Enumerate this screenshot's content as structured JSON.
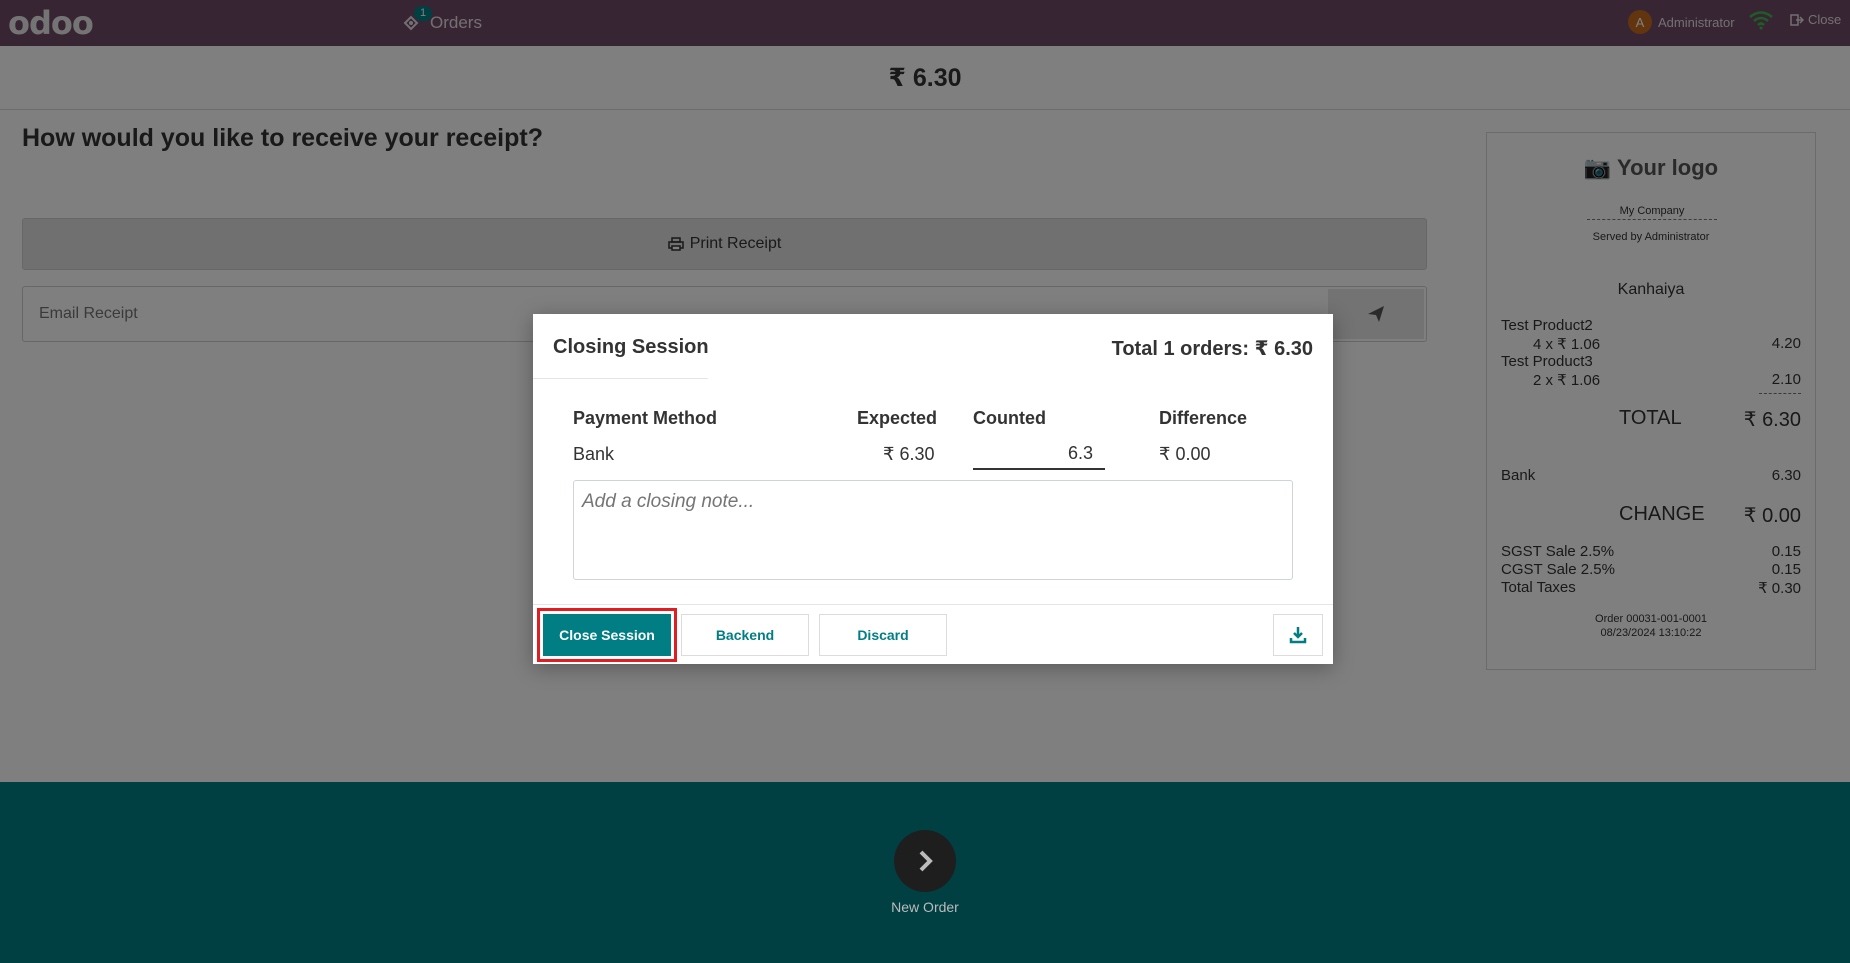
{
  "navbar": {
    "logo": "odoo",
    "orders_label": "Orders",
    "orders_count": "1",
    "user_initial": "A",
    "user_name": "Administrator",
    "close_label": "Close"
  },
  "main": {
    "total": "₹ 6.30",
    "question": "How would you like to receive your receipt?",
    "print_label": "Print Receipt",
    "email_placeholder": "Email Receipt",
    "new_order_label": "New Order"
  },
  "receipt": {
    "logo": "Your logo",
    "company": "My Company",
    "served_by": "Served by Administrator",
    "customer": "Kanhaiya",
    "lines": [
      {
        "product": "Test Product2",
        "qty": "4 x ₹ 1.06",
        "amount": "4.20"
      },
      {
        "product": "Test Product3",
        "qty": "2 x ₹ 1.06",
        "amount": "2.10"
      }
    ],
    "total_label": "TOTAL",
    "total_value": "₹ 6.30",
    "payment_method": "Bank",
    "payment_amount": "6.30",
    "change_label": "CHANGE",
    "change_value": "₹ 0.00",
    "taxes": [
      {
        "label": "SGST Sale 2.5%",
        "value": "0.15"
      },
      {
        "label": "CGST Sale 2.5%",
        "value": "0.15"
      },
      {
        "label": "Total Taxes",
        "value": "₹ 0.30"
      }
    ],
    "order_ref": "Order 00031-001-0001",
    "order_date": "08/23/2024 13:10:22"
  },
  "modal": {
    "title": "Closing Session",
    "total": "Total 1 orders: ₹ 6.30",
    "headers": {
      "method": "Payment Method",
      "expected": "Expected",
      "counted": "Counted",
      "difference": "Difference"
    },
    "row": {
      "method": "Bank",
      "expected": "₹ 6.30",
      "counted": "6.3",
      "difference": "₹ 0.00"
    },
    "note_placeholder": "Add a closing note...",
    "close_session_label": "Close Session",
    "backend_label": "Backend",
    "discard_label": "Discard"
  }
}
